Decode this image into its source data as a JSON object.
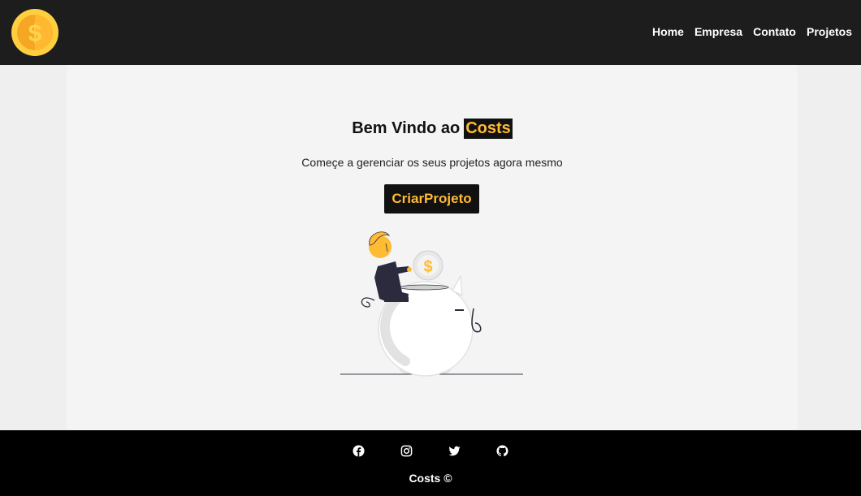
{
  "navbar": {
    "logo_icon": "coin-dollar-icon",
    "links": [
      {
        "label": "Home"
      },
      {
        "label": "Empresa"
      },
      {
        "label": "Contato"
      },
      {
        "label": "Projetos"
      }
    ]
  },
  "hero": {
    "title_prefix": "Bem Vindo ao",
    "title_brand": "Costs",
    "subtitle": "Começe a gerenciar os seus projetos agora mesmo",
    "cta_label": "CriarProjeto",
    "illustration": "piggy-bank-savings-illustration"
  },
  "footer": {
    "social": [
      {
        "icon": "facebook-icon"
      },
      {
        "icon": "instagram-icon"
      },
      {
        "icon": "twitter-icon"
      },
      {
        "icon": "github-icon"
      }
    ],
    "copyright_brand": "Costs",
    "copyright_symbol": "©"
  },
  "colors": {
    "navbar_bg": "#1d1d1d",
    "page_bg": "#efefef",
    "container_bg": "#f4f4f4",
    "accent": "#ffbb33",
    "footer_bg": "#000000"
  }
}
